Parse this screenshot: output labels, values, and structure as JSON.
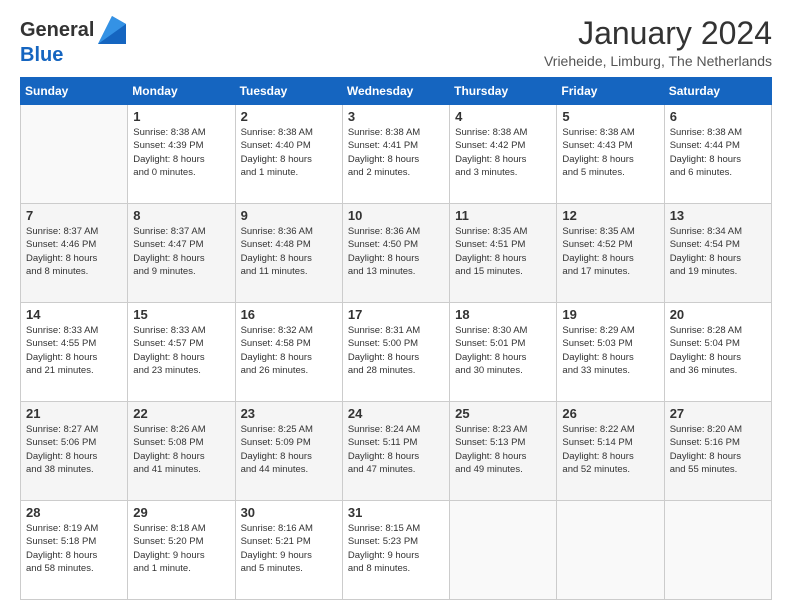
{
  "header": {
    "logo": {
      "general": "General",
      "blue": "Blue"
    },
    "title": "January 2024",
    "location": "Vrieheide, Limburg, The Netherlands"
  },
  "weekdays": [
    "Sunday",
    "Monday",
    "Tuesday",
    "Wednesday",
    "Thursday",
    "Friday",
    "Saturday"
  ],
  "weeks": [
    [
      {
        "day": "",
        "info": ""
      },
      {
        "day": "1",
        "info": "Sunrise: 8:38 AM\nSunset: 4:39 PM\nDaylight: 8 hours\nand 0 minutes."
      },
      {
        "day": "2",
        "info": "Sunrise: 8:38 AM\nSunset: 4:40 PM\nDaylight: 8 hours\nand 1 minute."
      },
      {
        "day": "3",
        "info": "Sunrise: 8:38 AM\nSunset: 4:41 PM\nDaylight: 8 hours\nand 2 minutes."
      },
      {
        "day": "4",
        "info": "Sunrise: 8:38 AM\nSunset: 4:42 PM\nDaylight: 8 hours\nand 3 minutes."
      },
      {
        "day": "5",
        "info": "Sunrise: 8:38 AM\nSunset: 4:43 PM\nDaylight: 8 hours\nand 5 minutes."
      },
      {
        "day": "6",
        "info": "Sunrise: 8:38 AM\nSunset: 4:44 PM\nDaylight: 8 hours\nand 6 minutes."
      }
    ],
    [
      {
        "day": "7",
        "info": "Sunrise: 8:37 AM\nSunset: 4:46 PM\nDaylight: 8 hours\nand 8 minutes."
      },
      {
        "day": "8",
        "info": "Sunrise: 8:37 AM\nSunset: 4:47 PM\nDaylight: 8 hours\nand 9 minutes."
      },
      {
        "day": "9",
        "info": "Sunrise: 8:36 AM\nSunset: 4:48 PM\nDaylight: 8 hours\nand 11 minutes."
      },
      {
        "day": "10",
        "info": "Sunrise: 8:36 AM\nSunset: 4:50 PM\nDaylight: 8 hours\nand 13 minutes."
      },
      {
        "day": "11",
        "info": "Sunrise: 8:35 AM\nSunset: 4:51 PM\nDaylight: 8 hours\nand 15 minutes."
      },
      {
        "day": "12",
        "info": "Sunrise: 8:35 AM\nSunset: 4:52 PM\nDaylight: 8 hours\nand 17 minutes."
      },
      {
        "day": "13",
        "info": "Sunrise: 8:34 AM\nSunset: 4:54 PM\nDaylight: 8 hours\nand 19 minutes."
      }
    ],
    [
      {
        "day": "14",
        "info": "Sunrise: 8:33 AM\nSunset: 4:55 PM\nDaylight: 8 hours\nand 21 minutes."
      },
      {
        "day": "15",
        "info": "Sunrise: 8:33 AM\nSunset: 4:57 PM\nDaylight: 8 hours\nand 23 minutes."
      },
      {
        "day": "16",
        "info": "Sunrise: 8:32 AM\nSunset: 4:58 PM\nDaylight: 8 hours\nand 26 minutes."
      },
      {
        "day": "17",
        "info": "Sunrise: 8:31 AM\nSunset: 5:00 PM\nDaylight: 8 hours\nand 28 minutes."
      },
      {
        "day": "18",
        "info": "Sunrise: 8:30 AM\nSunset: 5:01 PM\nDaylight: 8 hours\nand 30 minutes."
      },
      {
        "day": "19",
        "info": "Sunrise: 8:29 AM\nSunset: 5:03 PM\nDaylight: 8 hours\nand 33 minutes."
      },
      {
        "day": "20",
        "info": "Sunrise: 8:28 AM\nSunset: 5:04 PM\nDaylight: 8 hours\nand 36 minutes."
      }
    ],
    [
      {
        "day": "21",
        "info": "Sunrise: 8:27 AM\nSunset: 5:06 PM\nDaylight: 8 hours\nand 38 minutes."
      },
      {
        "day": "22",
        "info": "Sunrise: 8:26 AM\nSunset: 5:08 PM\nDaylight: 8 hours\nand 41 minutes."
      },
      {
        "day": "23",
        "info": "Sunrise: 8:25 AM\nSunset: 5:09 PM\nDaylight: 8 hours\nand 44 minutes."
      },
      {
        "day": "24",
        "info": "Sunrise: 8:24 AM\nSunset: 5:11 PM\nDaylight: 8 hours\nand 47 minutes."
      },
      {
        "day": "25",
        "info": "Sunrise: 8:23 AM\nSunset: 5:13 PM\nDaylight: 8 hours\nand 49 minutes."
      },
      {
        "day": "26",
        "info": "Sunrise: 8:22 AM\nSunset: 5:14 PM\nDaylight: 8 hours\nand 52 minutes."
      },
      {
        "day": "27",
        "info": "Sunrise: 8:20 AM\nSunset: 5:16 PM\nDaylight: 8 hours\nand 55 minutes."
      }
    ],
    [
      {
        "day": "28",
        "info": "Sunrise: 8:19 AM\nSunset: 5:18 PM\nDaylight: 8 hours\nand 58 minutes."
      },
      {
        "day": "29",
        "info": "Sunrise: 8:18 AM\nSunset: 5:20 PM\nDaylight: 9 hours\nand 1 minute."
      },
      {
        "day": "30",
        "info": "Sunrise: 8:16 AM\nSunset: 5:21 PM\nDaylight: 9 hours\nand 5 minutes."
      },
      {
        "day": "31",
        "info": "Sunrise: 8:15 AM\nSunset: 5:23 PM\nDaylight: 9 hours\nand 8 minutes."
      },
      {
        "day": "",
        "info": ""
      },
      {
        "day": "",
        "info": ""
      },
      {
        "day": "",
        "info": ""
      }
    ]
  ]
}
